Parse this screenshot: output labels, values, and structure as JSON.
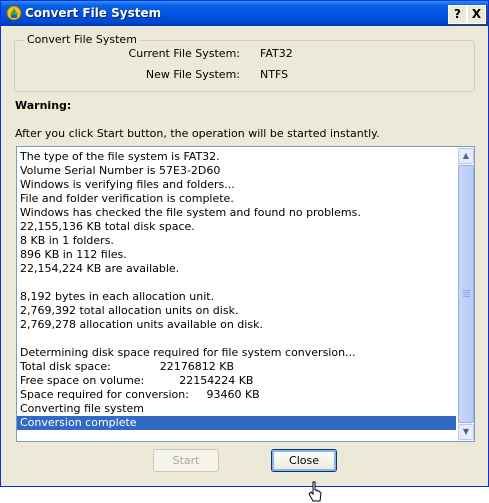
{
  "window": {
    "title": "Convert File System",
    "help_label": "?",
    "close_label": "X"
  },
  "group": {
    "legend": "Convert File System",
    "current_label": "Current File System:",
    "current_value": "FAT32",
    "new_label": "New File System:",
    "new_value": "NTFS"
  },
  "warning": "Warning:",
  "instruction": "After you click Start button, the operation will be started instantly.",
  "log": [
    "The type of the file system is FAT32.",
    "Volume Serial Number is 57E3-2D60",
    "Windows is verifying files and folders...",
    "File and folder verification is complete.",
    "Windows has checked the file system and found no problems.",
    "22,155,136 KB total disk space.",
    "8 KB in 1 folders.",
    "896 KB in 112 files.",
    "22,154,224 KB are available.",
    "",
    "8,192 bytes in each allocation unit.",
    "2,769,392 total allocation units on disk.",
    "2,769,278 allocation units available on disk.",
    "",
    "Determining disk space required for file system conversion...",
    "Total disk space:              22176812 KB",
    "Free space on volume:          22154224 KB",
    "Space required for conversion:     93460 KB",
    "Converting file system",
    "Conversion complete"
  ],
  "selected_line": "Conversion complete",
  "buttons": {
    "start": "Start",
    "close": "Close"
  },
  "colors": {
    "titlebar": "#0054e3",
    "selection": "#316ac5",
    "face": "#ece9d8"
  }
}
